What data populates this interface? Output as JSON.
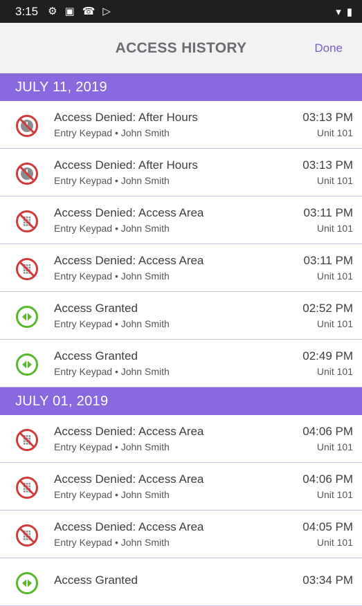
{
  "status_bar": {
    "time": "3:15",
    "icons": [
      "settings-icon",
      "sim-icon",
      "notification-icon",
      "play-store-icon"
    ]
  },
  "header": {
    "title": "ACCESS HISTORY",
    "done_label": "Done"
  },
  "colors": {
    "accent": "#8a68df",
    "denied": "#cf3b3b",
    "granted": "#57b82a"
  },
  "sections": [
    {
      "date": "JULY 11, 2019",
      "entries": [
        {
          "status": "denied-hours",
          "title": "Access Denied: After Hours",
          "sub": "Entry Keypad • John Smith",
          "time": "03:13 PM",
          "unit": "Unit 101"
        },
        {
          "status": "denied-hours",
          "title": "Access Denied: After Hours",
          "sub": "Entry Keypad • John Smith",
          "time": "03:13 PM",
          "unit": "Unit 101"
        },
        {
          "status": "denied-area",
          "title": "Access Denied: Access Area",
          "sub": "Entry Keypad • John Smith",
          "time": "03:11 PM",
          "unit": "Unit 101"
        },
        {
          "status": "denied-area",
          "title": "Access Denied: Access Area",
          "sub": "Entry Keypad • John Smith",
          "time": "03:11 PM",
          "unit": "Unit 101"
        },
        {
          "status": "granted",
          "title": "Access Granted",
          "sub": "Entry Keypad • John Smith",
          "time": "02:52 PM",
          "unit": "Unit 101"
        },
        {
          "status": "granted",
          "title": "Access Granted",
          "sub": "Entry Keypad • John Smith",
          "time": "02:49 PM",
          "unit": "Unit 101"
        }
      ]
    },
    {
      "date": "JULY 01, 2019",
      "entries": [
        {
          "status": "denied-area",
          "title": "Access Denied: Access Area",
          "sub": "Entry Keypad • John Smith",
          "time": "04:06 PM",
          "unit": "Unit 101"
        },
        {
          "status": "denied-area",
          "title": "Access Denied: Access Area",
          "sub": "Entry Keypad • John Smith",
          "time": "04:06 PM",
          "unit": "Unit 101"
        },
        {
          "status": "denied-area",
          "title": "Access Denied: Access Area",
          "sub": "Entry Keypad • John Smith",
          "time": "04:05 PM",
          "unit": "Unit 101"
        },
        {
          "status": "granted",
          "title": "Access Granted",
          "sub": "",
          "time": "03:34 PM",
          "unit": ""
        }
      ]
    }
  ]
}
